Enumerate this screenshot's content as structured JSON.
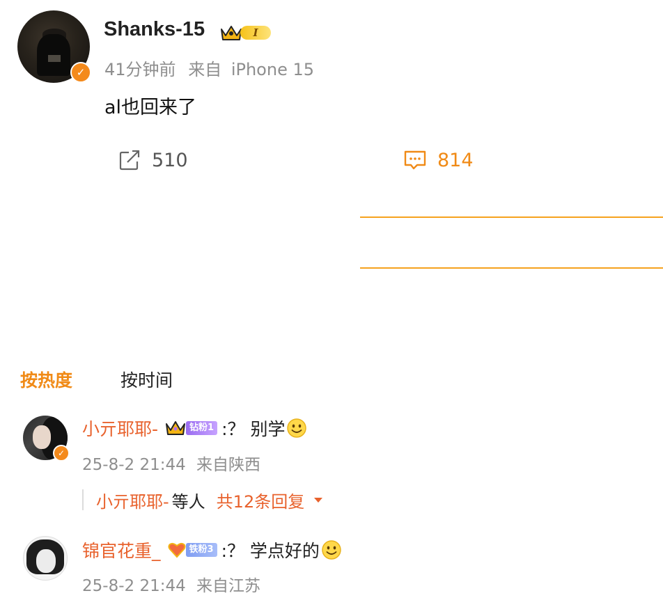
{
  "post": {
    "author": "Shanks-15",
    "vip_level": "I",
    "time": "41分钟前",
    "source_prefix": "来自",
    "source": "iPhone 15",
    "text": "al也回来了",
    "repost_count": "510",
    "comment_count": "814"
  },
  "sort": {
    "hot_label": "按热度",
    "time_label": "按时间"
  },
  "comments": [
    {
      "user": "小亓耶耶-",
      "badge": "钻粉1",
      "text": ":？ 别学",
      "date": "25-8-2 21:44",
      "location": "来自陕西",
      "reply_user": "小亓耶耶-",
      "reply_mid": "等人",
      "reply_count": "共12条回复"
    },
    {
      "user": "锦官花重_",
      "badge": "铁粉3",
      "text": ":？ 学点好的",
      "date": "25-8-2 21:44",
      "location": "来自江苏"
    }
  ],
  "colors": {
    "accent": "#f08a16",
    "username": "#e8622d",
    "meta": "#8e8e8e",
    "divider": "#f6a21e"
  },
  "icons": [
    "verified-icon",
    "crown-icon",
    "repost-icon",
    "comment-icon",
    "smile-icon",
    "caret-down-icon"
  ]
}
